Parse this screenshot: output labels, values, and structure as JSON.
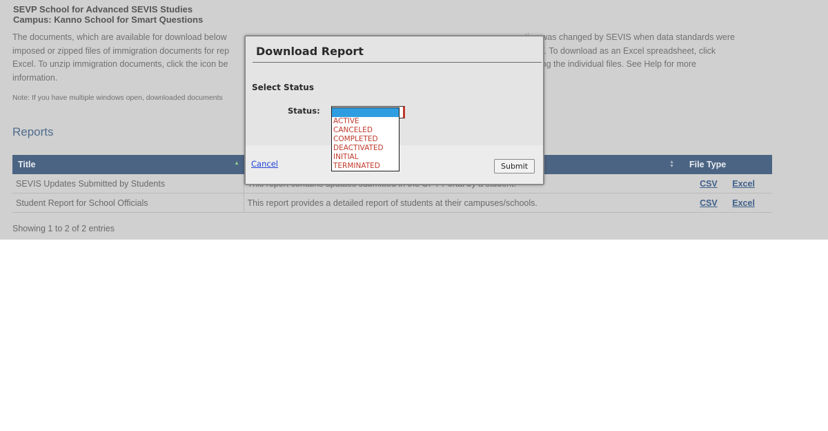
{
  "header": {
    "school": "SEVP School for Advanced SEVIS Studies",
    "campus": "Campus: Kanno School for Smart Questions"
  },
  "intro": {
    "line1": "The documents, which are available for download below",
    "line1_end": "tion was changed by SEVIS when data standards were",
    "line2": "imposed or zipped files of immigration documents for rep",
    "line2_end": "CSV. To download as an Excel spreadsheet, click",
    "line3": "Excel. To unzip immigration documents, click the icon be",
    "line3_end": "essing the individual files. See Help for more",
    "line4": "information.",
    "note": "Note: If you have multiple windows open, downloaded documents"
  },
  "reports": {
    "heading": "Reports",
    "columns": {
      "title": "Title",
      "file_type": "File Type"
    },
    "rows": [
      {
        "title": "SEVIS Updates Submitted by Students",
        "description": "This report contains updates submitted in the OPT Portal by a student.",
        "csv": "CSV",
        "excel": "Excel"
      },
      {
        "title": "Student Report for School Officials",
        "description": "This report provides a detailed report of students at their campuses/schools.",
        "csv": "CSV",
        "excel": "Excel"
      }
    ],
    "showing": "Showing 1 to 2 of 2 entries"
  },
  "modal": {
    "title": "Download Report",
    "section": "Select Status",
    "status_label": "Status:",
    "options": [
      "",
      "ACTIVE",
      "CANCELED",
      "COMPLETED",
      "DEACTIVATED",
      "INITIAL",
      "TERMINATED"
    ],
    "cancel_label": "Cancel",
    "submit_label": "Submit"
  },
  "colors": {
    "overlay_gray": "#d0d0d0",
    "table_header": "#4c6483",
    "option_text": "#c0392b",
    "option_highlight": "#2f9ee0",
    "link_blue": "#1f3fd8"
  }
}
